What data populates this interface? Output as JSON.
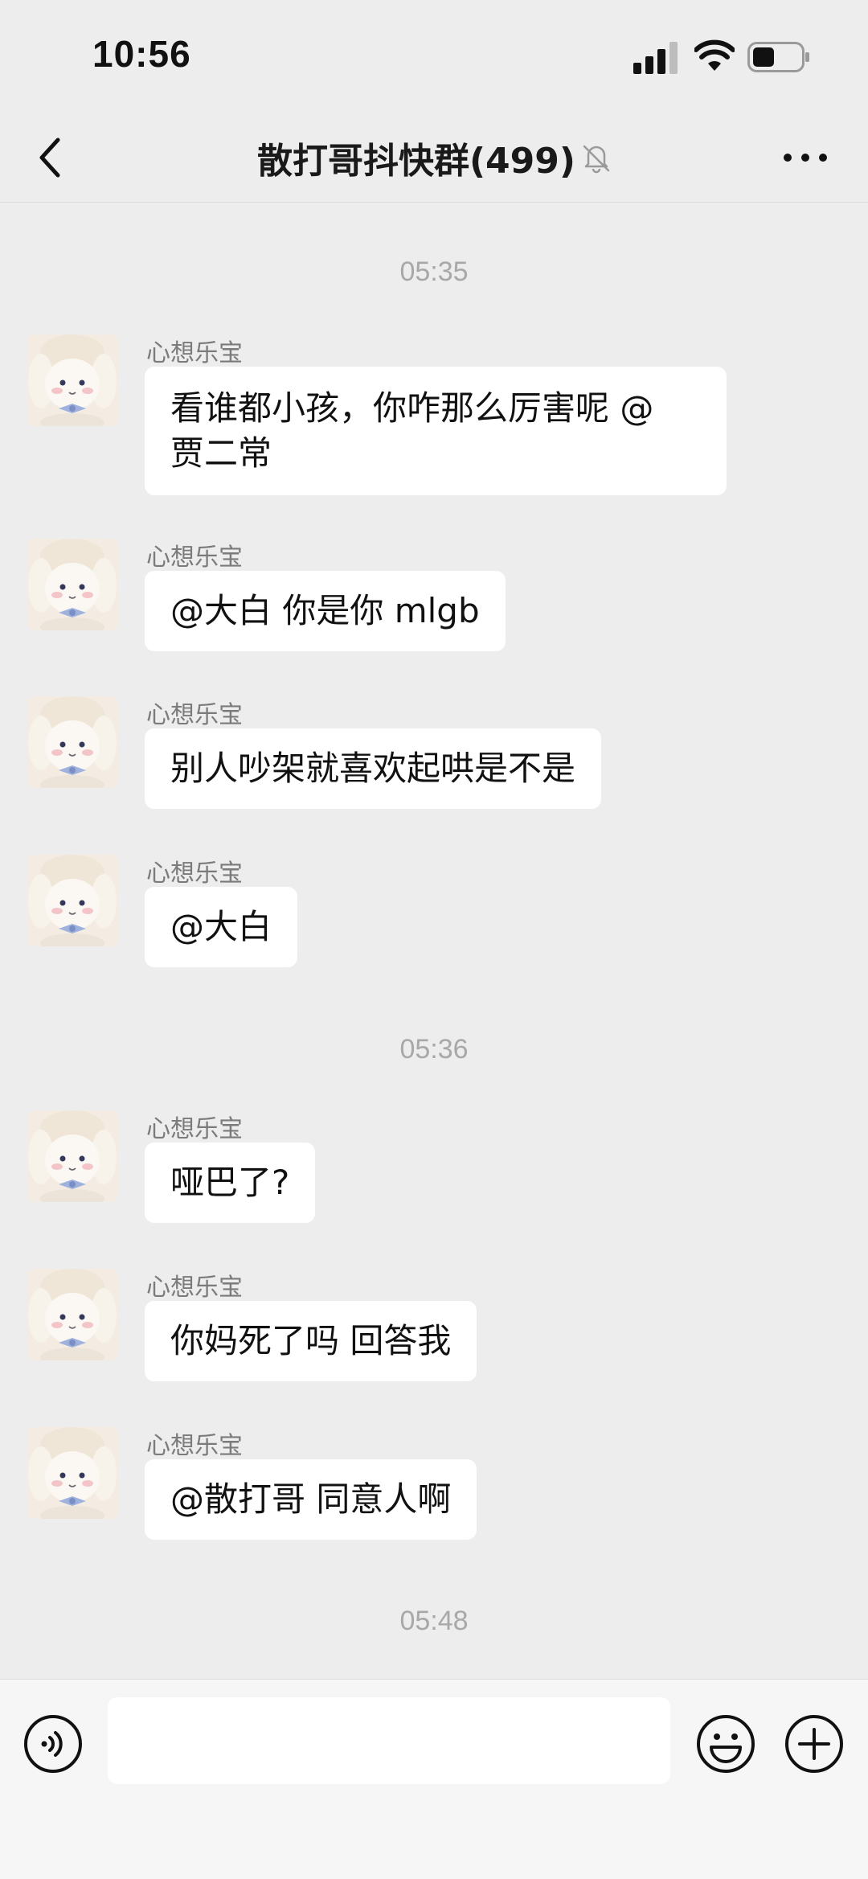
{
  "status_bar": {
    "time": "10:56"
  },
  "nav": {
    "title": "散打哥抖快群(499)",
    "back_icon": "chevron-left-icon",
    "mute_icon": "bell-muted-icon",
    "more_icon": "more-dots-icon"
  },
  "chat": {
    "timestamps": [
      "05:35",
      "05:36",
      "05:48"
    ],
    "messages": [
      {
        "sender": "心想乐宝",
        "text": "看谁都小孩，你咋那么厉害呢 @\n贾二常"
      },
      {
        "sender": "心想乐宝",
        "text": "@大白 你是你 mlgb"
      },
      {
        "sender": "心想乐宝",
        "text": "别人吵架就喜欢起哄是不是"
      },
      {
        "sender": "心想乐宝",
        "text": "@大白"
      },
      {
        "sender": "心想乐宝",
        "text": "哑巴了?"
      },
      {
        "sender": "心想乐宝",
        "text": "你妈死了吗 回答我"
      },
      {
        "sender": "心想乐宝",
        "text": "@散打哥 同意人啊"
      }
    ]
  },
  "input_bar": {
    "value": "",
    "voice_icon": "voice-icon",
    "emoji_icon": "emoji-icon",
    "plus_icon": "plus-icon"
  },
  "colors": {
    "background": "#ededed",
    "bubble": "#ffffff",
    "timestamp": "#a8a8a8",
    "sender": "#7b7b7b"
  }
}
